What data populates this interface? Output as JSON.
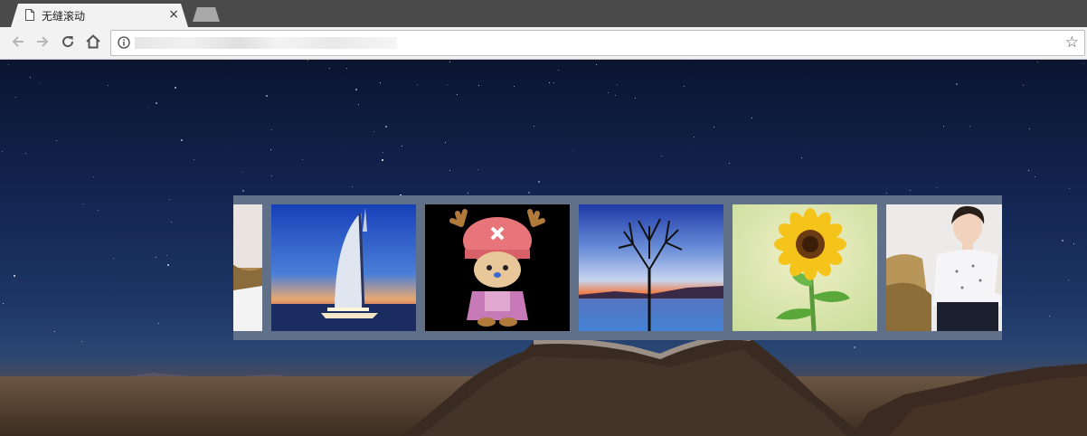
{
  "browser": {
    "tab_title": "无缝滚动",
    "tab_close": "×",
    "address_placeholder": ""
  },
  "icons": {
    "back": "arrow-left-icon",
    "forward": "arrow-right-icon",
    "reload": "reload-icon",
    "home": "home-icon",
    "info": "info-icon",
    "bookmark": "star-icon",
    "tab_doc": "document-icon"
  },
  "page": {
    "marquee": {
      "background_color": "#5f7088",
      "slides": [
        {
          "subject": "woman-partial"
        },
        {
          "subject": "burj-al-arab"
        },
        {
          "subject": "chopper"
        },
        {
          "subject": "tree-sunset"
        },
        {
          "subject": "sunflower"
        },
        {
          "subject": "woman"
        }
      ]
    }
  },
  "colors": {
    "chrome_bg": "#f2f2f2",
    "tabstrip_bg": "#4a4a4a",
    "sky_top": "#0b1530"
  }
}
